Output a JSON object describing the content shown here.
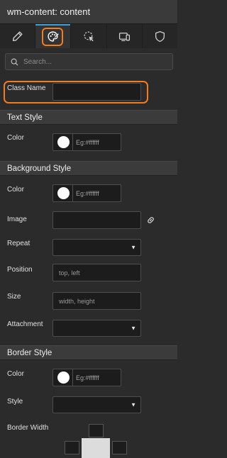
{
  "header": {
    "title": "wm-content: content"
  },
  "tabs": [
    {
      "name": "pencil-icon"
    },
    {
      "name": "style-palette-icon",
      "active": true
    },
    {
      "name": "cursor-events-icon"
    },
    {
      "name": "devices-icon"
    },
    {
      "name": "shield-icon"
    }
  ],
  "search": {
    "placeholder": "Search..."
  },
  "class_name": {
    "label": "Class Name",
    "value": ""
  },
  "text_style": {
    "title": "Text Style",
    "color_label": "Color",
    "color_placeholder": "Eg:#ffffff",
    "swatch": "#ffffff"
  },
  "background_style": {
    "title": "Background Style",
    "color_label": "Color",
    "color_placeholder": "Eg:#ffffff",
    "swatch": "#ffffff",
    "image_label": "Image",
    "repeat_label": "Repeat",
    "position_label": "Position",
    "position_placeholder": "top, left",
    "size_label": "Size",
    "size_placeholder": "width, height",
    "attachment_label": "Attachment"
  },
  "border_style": {
    "title": "Border Style",
    "color_label": "Color",
    "color_placeholder": "Eg:#ffffff",
    "swatch": "#ffffff",
    "style_label": "Style",
    "width_label": "Border Width"
  },
  "colors": {
    "accent": "#3ea0d8",
    "highlight": "#f27d21"
  },
  "dropdown_caret": "▼"
}
